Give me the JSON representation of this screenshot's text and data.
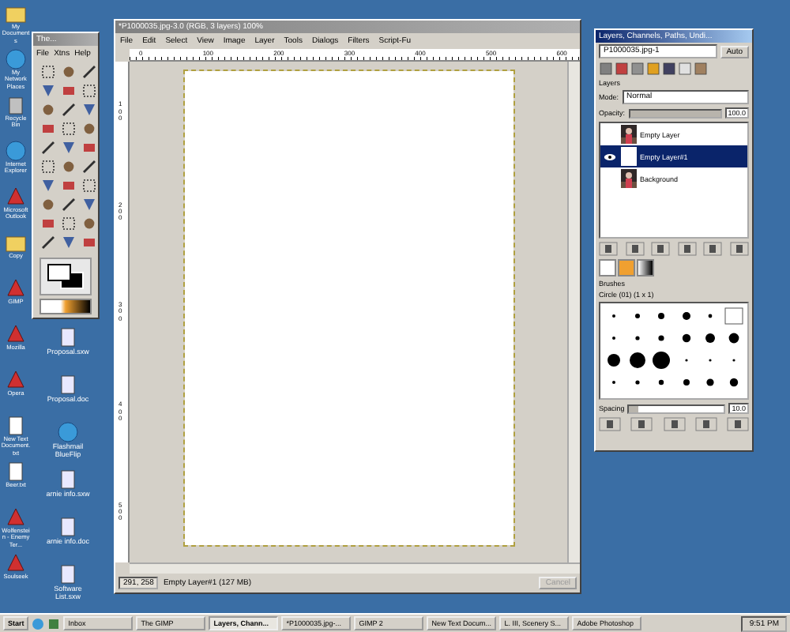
{
  "desktop": {
    "column_1": [
      {
        "label": "My Documents",
        "kind": "folder"
      },
      {
        "label": "My Network Places",
        "kind": "globe"
      },
      {
        "label": "Recycle Bin",
        "kind": "bin"
      },
      {
        "label": "Internet Explorer",
        "kind": "globe"
      },
      {
        "label": "Microsoft Outlook",
        "kind": "app"
      },
      {
        "label": "Copy",
        "kind": "folder"
      },
      {
        "label": "GIMP",
        "kind": "app"
      },
      {
        "label": "Mozilla",
        "kind": "app"
      },
      {
        "label": "Opera",
        "kind": "app"
      },
      {
        "label": "New Text Document.txt",
        "kind": "text"
      },
      {
        "label": "Beer.txt",
        "kind": "text"
      },
      {
        "label": "Wolfenstein - Enemy Ter...",
        "kind": "app"
      },
      {
        "label": "Soulseek",
        "kind": "app"
      }
    ],
    "column_2": [
      {
        "label": "Proposal.sxw",
        "kind": "doc"
      },
      {
        "label": "Proposal.doc",
        "kind": "doc"
      },
      {
        "label": "Flashmail BlueFlip",
        "kind": "globe"
      },
      {
        "label": "arnie info.sxw",
        "kind": "doc"
      },
      {
        "label": "arnie info.doc",
        "kind": "doc"
      },
      {
        "label": "Software List.sxw",
        "kind": "doc"
      }
    ]
  },
  "toolbox": {
    "title": "The...",
    "menu": [
      "File",
      "Xtns",
      "Help"
    ]
  },
  "image_window": {
    "title": "*P1000035.jpg-3.0 (RGB, 3 layers) 100%",
    "menu": [
      "File",
      "Edit",
      "Select",
      "View",
      "Image",
      "Layer",
      "Tools",
      "Dialogs",
      "Filters",
      "Script-Fu"
    ],
    "ruler_labels": [
      "0",
      "100",
      "200",
      "300",
      "400",
      "500",
      "600"
    ],
    "vertical_ruler_labels": [
      "100",
      "200",
      "300",
      "400",
      "500"
    ],
    "status": {
      "coords": "291, 258",
      "message": "Empty Layer#1 (127 MB)",
      "cancel": {
        "label": "Cancel",
        "disabled": true
      }
    }
  },
  "layers_dialog": {
    "title": "Layers, Channels, Paths, Undi...",
    "image": "P1000035.jpg-1",
    "auto": "Auto",
    "section": "Layers",
    "mode_label": "Mode:",
    "mode": "Normal",
    "opacity_label": "Opacity:",
    "opacity": "100.0",
    "opacity_slider": {
      "level": 1
    },
    "layers": [
      {
        "name": "Empty Layer",
        "selected": false,
        "visible": false
      },
      {
        "name": "Empty Layer#1",
        "selected": true,
        "visible": true
      },
      {
        "name": "Background",
        "selected": false,
        "visible": false
      }
    ],
    "brushes": {
      "title": "Brushes",
      "current": "Circle (01) (1 x 1)",
      "spacing_label": "Spacing",
      "spacing": "10.0",
      "spacing_slider": {
        "level": 0.1
      }
    }
  },
  "taskbar": {
    "start": "Start",
    "tasks": [
      {
        "label": "Inbox",
        "selected": false
      },
      {
        "label": "The GIMP",
        "selected": false
      },
      {
        "label": "Layers, Chann...",
        "selected": true
      },
      {
        "label": "*P1000035.jpg-...",
        "selected": false
      },
      {
        "label": "GIMP 2",
        "selected": false
      },
      {
        "label": "New Text Docum...",
        "selected": false
      },
      {
        "label": "L. III, Scenery S...",
        "selected": false
      },
      {
        "label": "Adobe Photoshop",
        "selected": false
      }
    ],
    "clock": "9:51 PM"
  }
}
